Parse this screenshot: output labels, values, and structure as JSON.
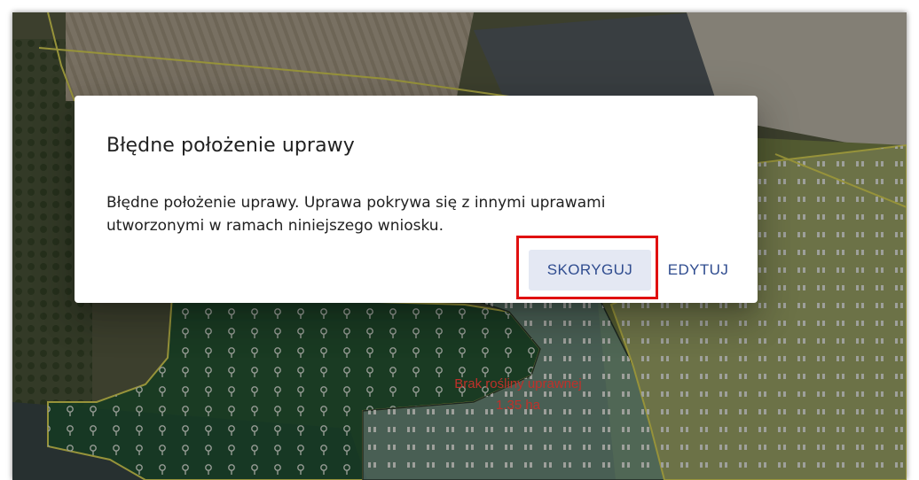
{
  "dialog": {
    "title": "Błędne położenie uprawy",
    "message": "Błędne położenie uprawy. Uprawa pokrywa się z innymi uprawami utworzonymi w ramach niniejszego wniosku.",
    "actions": {
      "primary_label": "SKORYGUJ",
      "secondary_label": "EDYTUJ"
    }
  },
  "map": {
    "parcel_label": {
      "name": "Brak rośliny uprawnej",
      "area": "1.35 ha"
    }
  },
  "colors": {
    "accent": "#2f4c8f",
    "highlight": "#e01010",
    "parcel_border": "#e8e25a",
    "label_red": "#c0302a"
  }
}
